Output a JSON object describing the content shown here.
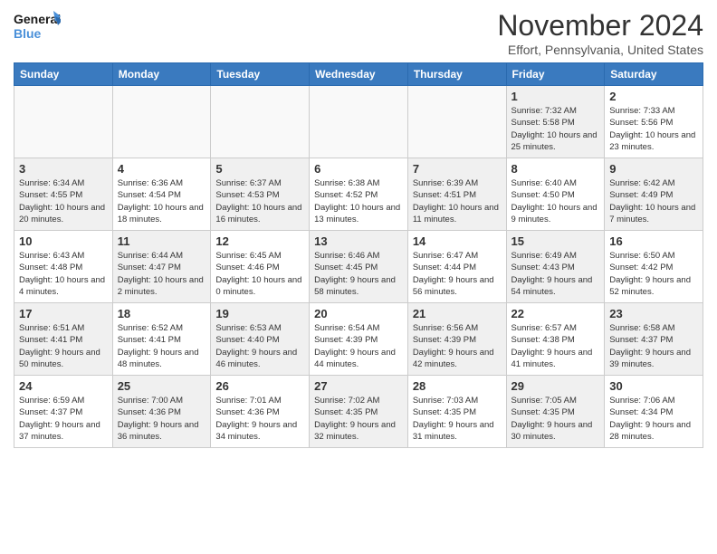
{
  "logo": {
    "line1": "General",
    "line2": "Blue"
  },
  "title": "November 2024",
  "location": "Effort, Pennsylvania, United States",
  "days_header": [
    "Sunday",
    "Monday",
    "Tuesday",
    "Wednesday",
    "Thursday",
    "Friday",
    "Saturday"
  ],
  "weeks": [
    [
      {
        "day": "",
        "info": "",
        "empty": true
      },
      {
        "day": "",
        "info": "",
        "empty": true
      },
      {
        "day": "",
        "info": "",
        "empty": true
      },
      {
        "day": "",
        "info": "",
        "empty": true
      },
      {
        "day": "",
        "info": "",
        "empty": true
      },
      {
        "day": "1",
        "info": "Sunrise: 7:32 AM\nSunset: 5:58 PM\nDaylight: 10 hours and 25 minutes."
      },
      {
        "day": "2",
        "info": "Sunrise: 7:33 AM\nSunset: 5:56 PM\nDaylight: 10 hours and 23 minutes."
      }
    ],
    [
      {
        "day": "3",
        "info": "Sunrise: 6:34 AM\nSunset: 4:55 PM\nDaylight: 10 hours and 20 minutes."
      },
      {
        "day": "4",
        "info": "Sunrise: 6:36 AM\nSunset: 4:54 PM\nDaylight: 10 hours and 18 minutes."
      },
      {
        "day": "5",
        "info": "Sunrise: 6:37 AM\nSunset: 4:53 PM\nDaylight: 10 hours and 16 minutes."
      },
      {
        "day": "6",
        "info": "Sunrise: 6:38 AM\nSunset: 4:52 PM\nDaylight: 10 hours and 13 minutes."
      },
      {
        "day": "7",
        "info": "Sunrise: 6:39 AM\nSunset: 4:51 PM\nDaylight: 10 hours and 11 minutes."
      },
      {
        "day": "8",
        "info": "Sunrise: 6:40 AM\nSunset: 4:50 PM\nDaylight: 10 hours and 9 minutes."
      },
      {
        "day": "9",
        "info": "Sunrise: 6:42 AM\nSunset: 4:49 PM\nDaylight: 10 hours and 7 minutes."
      }
    ],
    [
      {
        "day": "10",
        "info": "Sunrise: 6:43 AM\nSunset: 4:48 PM\nDaylight: 10 hours and 4 minutes."
      },
      {
        "day": "11",
        "info": "Sunrise: 6:44 AM\nSunset: 4:47 PM\nDaylight: 10 hours and 2 minutes."
      },
      {
        "day": "12",
        "info": "Sunrise: 6:45 AM\nSunset: 4:46 PM\nDaylight: 10 hours and 0 minutes."
      },
      {
        "day": "13",
        "info": "Sunrise: 6:46 AM\nSunset: 4:45 PM\nDaylight: 9 hours and 58 minutes."
      },
      {
        "day": "14",
        "info": "Sunrise: 6:47 AM\nSunset: 4:44 PM\nDaylight: 9 hours and 56 minutes."
      },
      {
        "day": "15",
        "info": "Sunrise: 6:49 AM\nSunset: 4:43 PM\nDaylight: 9 hours and 54 minutes."
      },
      {
        "day": "16",
        "info": "Sunrise: 6:50 AM\nSunset: 4:42 PM\nDaylight: 9 hours and 52 minutes."
      }
    ],
    [
      {
        "day": "17",
        "info": "Sunrise: 6:51 AM\nSunset: 4:41 PM\nDaylight: 9 hours and 50 minutes."
      },
      {
        "day": "18",
        "info": "Sunrise: 6:52 AM\nSunset: 4:41 PM\nDaylight: 9 hours and 48 minutes."
      },
      {
        "day": "19",
        "info": "Sunrise: 6:53 AM\nSunset: 4:40 PM\nDaylight: 9 hours and 46 minutes."
      },
      {
        "day": "20",
        "info": "Sunrise: 6:54 AM\nSunset: 4:39 PM\nDaylight: 9 hours and 44 minutes."
      },
      {
        "day": "21",
        "info": "Sunrise: 6:56 AM\nSunset: 4:39 PM\nDaylight: 9 hours and 42 minutes."
      },
      {
        "day": "22",
        "info": "Sunrise: 6:57 AM\nSunset: 4:38 PM\nDaylight: 9 hours and 41 minutes."
      },
      {
        "day": "23",
        "info": "Sunrise: 6:58 AM\nSunset: 4:37 PM\nDaylight: 9 hours and 39 minutes."
      }
    ],
    [
      {
        "day": "24",
        "info": "Sunrise: 6:59 AM\nSunset: 4:37 PM\nDaylight: 9 hours and 37 minutes."
      },
      {
        "day": "25",
        "info": "Sunrise: 7:00 AM\nSunset: 4:36 PM\nDaylight: 9 hours and 36 minutes."
      },
      {
        "day": "26",
        "info": "Sunrise: 7:01 AM\nSunset: 4:36 PM\nDaylight: 9 hours and 34 minutes."
      },
      {
        "day": "27",
        "info": "Sunrise: 7:02 AM\nSunset: 4:35 PM\nDaylight: 9 hours and 32 minutes."
      },
      {
        "day": "28",
        "info": "Sunrise: 7:03 AM\nSunset: 4:35 PM\nDaylight: 9 hours and 31 minutes."
      },
      {
        "day": "29",
        "info": "Sunrise: 7:05 AM\nSunset: 4:35 PM\nDaylight: 9 hours and 30 minutes."
      },
      {
        "day": "30",
        "info": "Sunrise: 7:06 AM\nSunset: 4:34 PM\nDaylight: 9 hours and 28 minutes."
      }
    ]
  ]
}
